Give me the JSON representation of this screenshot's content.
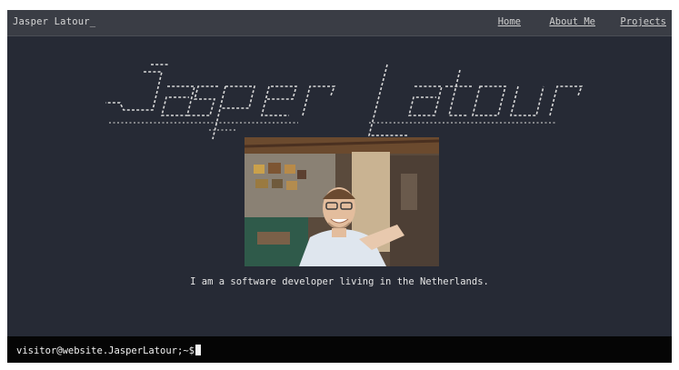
{
  "header": {
    "brand": "Jasper Latour_",
    "nav": [
      {
        "label": "Home"
      },
      {
        "label": "About Me"
      },
      {
        "label": "Projects"
      }
    ]
  },
  "hero": {
    "ascii_title": "Jasper Latour",
    "photo_alt": "Jasper Latour",
    "tagline": "I am a software developer living in the Netherlands."
  },
  "terminal": {
    "prompt": "visitor@website.JasperLatour;~$"
  },
  "colors": {
    "background": "#262a35",
    "topbar": "#3a3d45",
    "terminal": "#050505",
    "text": "#e6e6e6"
  }
}
